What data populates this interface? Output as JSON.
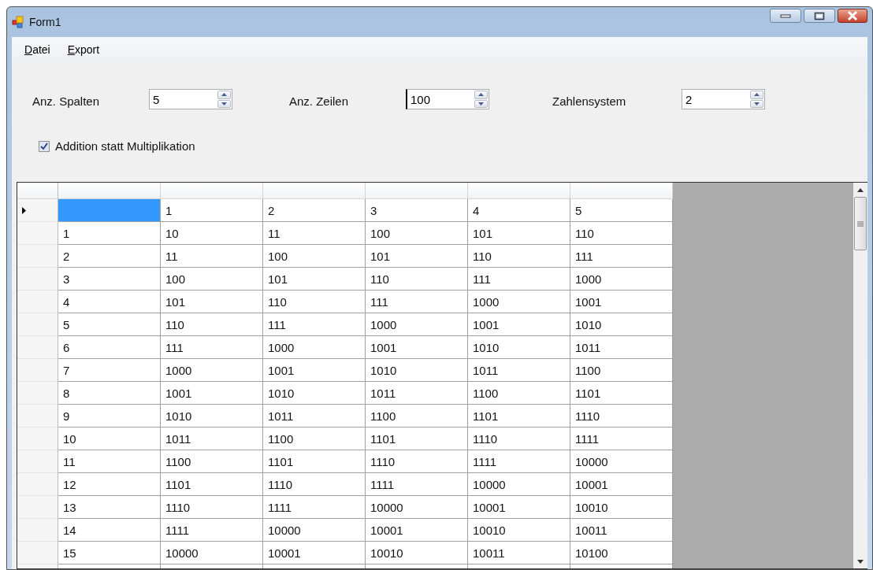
{
  "window": {
    "title": "Form1"
  },
  "menu": [
    "Datei",
    "Export"
  ],
  "spinners": [
    {
      "label": "Anz. Spalten",
      "value": "5",
      "focused": false
    },
    {
      "label": "Anz. Zeilen",
      "value": "100",
      "focused": true
    },
    {
      "label": "Zahlensystem",
      "value": "2",
      "focused": false
    }
  ],
  "checkbox": {
    "label": "Addition statt Multiplikation",
    "checked": true
  },
  "grid": {
    "rows": [
      {
        "current": true,
        "label_selected": true,
        "values": [
          "1",
          "2",
          "3",
          "4",
          "5"
        ]
      },
      {
        "current": false,
        "label_selected": false,
        "label": "1",
        "values": [
          "10",
          "11",
          "100",
          "101",
          "110"
        ]
      },
      {
        "current": false,
        "label_selected": false,
        "label": "2",
        "values": [
          "11",
          "100",
          "101",
          "110",
          "111"
        ]
      },
      {
        "current": false,
        "label_selected": false,
        "label": "3",
        "values": [
          "100",
          "101",
          "110",
          "111",
          "1000"
        ]
      },
      {
        "current": false,
        "label_selected": false,
        "label": "4",
        "values": [
          "101",
          "110",
          "111",
          "1000",
          "1001"
        ]
      },
      {
        "current": false,
        "label_selected": false,
        "label": "5",
        "values": [
          "110",
          "111",
          "1000",
          "1001",
          "1010"
        ]
      },
      {
        "current": false,
        "label_selected": false,
        "label": "6",
        "values": [
          "111",
          "1000",
          "1001",
          "1010",
          "1011"
        ]
      },
      {
        "current": false,
        "label_selected": false,
        "label": "7",
        "values": [
          "1000",
          "1001",
          "1010",
          "1011",
          "1100"
        ]
      },
      {
        "current": false,
        "label_selected": false,
        "label": "8",
        "values": [
          "1001",
          "1010",
          "1011",
          "1100",
          "1101"
        ]
      },
      {
        "current": false,
        "label_selected": false,
        "label": "9",
        "values": [
          "1010",
          "1011",
          "1100",
          "1101",
          "1110"
        ]
      },
      {
        "current": false,
        "label_selected": false,
        "label": "10",
        "values": [
          "1011",
          "1100",
          "1101",
          "1110",
          "1111"
        ]
      },
      {
        "current": false,
        "label_selected": false,
        "label": "11",
        "values": [
          "1100",
          "1101",
          "1110",
          "1111",
          "10000"
        ]
      },
      {
        "current": false,
        "label_selected": false,
        "label": "12",
        "values": [
          "1101",
          "1110",
          "1111",
          "10000",
          "10001"
        ]
      },
      {
        "current": false,
        "label_selected": false,
        "label": "13",
        "values": [
          "1110",
          "1111",
          "10000",
          "10001",
          "10010"
        ]
      },
      {
        "current": false,
        "label_selected": false,
        "label": "14",
        "values": [
          "1111",
          "10000",
          "10001",
          "10010",
          "10011"
        ]
      },
      {
        "current": false,
        "label_selected": false,
        "label": "15",
        "values": [
          "10000",
          "10001",
          "10010",
          "10011",
          "10100"
        ]
      }
    ]
  }
}
